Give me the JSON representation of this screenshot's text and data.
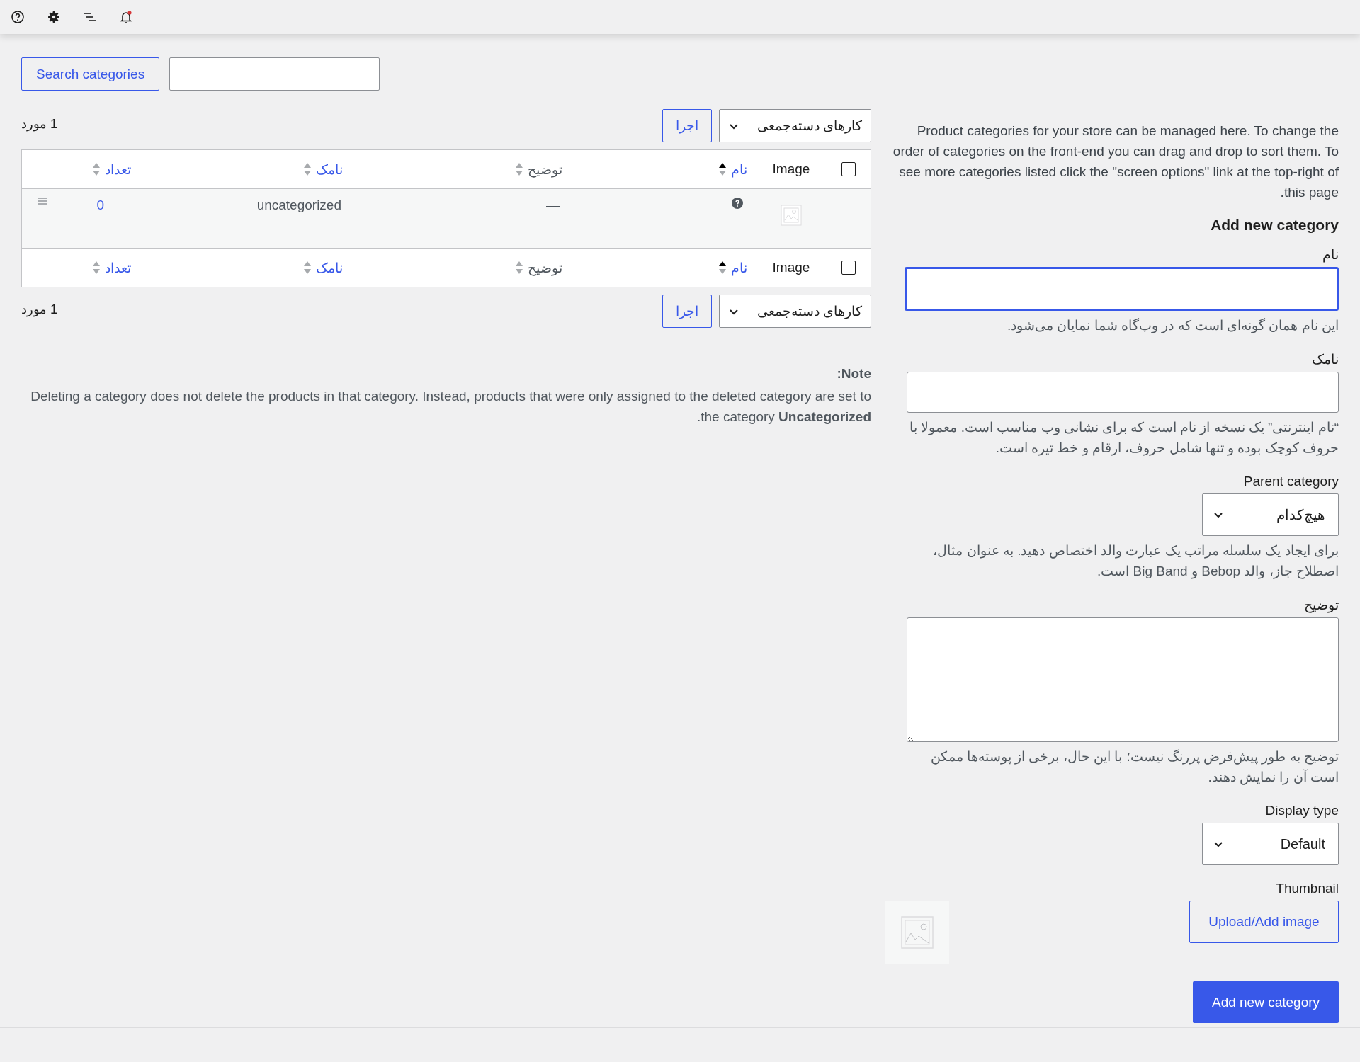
{
  "toolbar": {
    "items": [
      {
        "kind": "help"
      },
      {
        "kind": "settings"
      },
      {
        "kind": "menu"
      },
      {
        "kind": "notifications",
        "alert": true
      }
    ]
  },
  "search": {
    "button": "Search categories"
  },
  "bulk_top": {
    "action": "کارهای دسته‌جمعی",
    "apply": "اجرا",
    "count": "1 مورد"
  },
  "table": {
    "header_checkbox_checked": false,
    "header_columns": [
      {
        "label": "Image",
        "kind": "plain"
      },
      {
        "label": "نام",
        "kind": "sortable",
        "sorted": true
      },
      {
        "label": "توضیح",
        "kind": "sortable",
        "sorted": false
      },
      {
        "label": "نامک",
        "kind": "sortable",
        "sorted": false
      },
      {
        "label": "تعداد",
        "kind": "sortable",
        "sorted": false
      }
    ],
    "rows": [
      {
        "description": "—",
        "slug": "uncategorized",
        "count": "0"
      }
    ],
    "footer_checkbox_checked": false,
    "footer_columns": [
      {
        "label": "Image",
        "kind": "plain"
      },
      {
        "label": "نام",
        "kind": "sortable",
        "sorted": true
      },
      {
        "label": "توضیح",
        "kind": "sortable",
        "sorted": false
      },
      {
        "label": "نامک",
        "kind": "sortable",
        "sorted": false
      },
      {
        "label": "تعداد",
        "kind": "sortable",
        "sorted": false
      }
    ]
  },
  "bulk_bottom": {
    "action": "کارهای دسته‌جمعی",
    "apply": "اجرا",
    "count": "1 مورد"
  },
  "note": {
    "title": "Note:",
    "text": "Deleting a category does not delete the products in that category. Instead, products that were only assigned to the deleted category are set to the category **Uncategorized**."
  },
  "intro": "Product categories for your store can be managed here. To change the order of categories on the front-end you can drag and drop to sort them. To see more categories listed click the \"screen options\" link at the top-right of this page.",
  "form": {
    "heading": "Add new category",
    "fields": [
      {
        "kind": "input",
        "label": "نام",
        "focused": true,
        "hint": "این نام همان گونه‌ای است که در وب‌گاه شما نمایان می‌شود."
      },
      {
        "kind": "input",
        "label": "نامک",
        "focused": false,
        "hint": "“نام اینترنتی” یک نسخه از نام است که برای نشانی وب مناسب است. معمولا با حروف کوچک بوده و تنها شامل حروف، ارقام و خط تیره است."
      },
      {
        "kind": "select",
        "label": "Parent category",
        "value": "هیچ‌کدام",
        "hint": "برای ایجاد یک سلسله مراتب یک عبارت والد اختصاص دهید. به عنوان مثال، اصطلاح جاز، والد Bebop و Big Band است."
      },
      {
        "kind": "textarea",
        "label": "توضیح",
        "hint": "توضیح به طور پیش‌فرض پررنگ نیست؛ با این حال، برخی از پوسته‌ها ممکن است آن را نمایش دهند."
      },
      {
        "kind": "select",
        "label": "Display type",
        "value": "Default"
      },
      {
        "kind": "thumbnail",
        "label": "Thumbnail",
        "button": "Upload/Add image"
      }
    ],
    "submit": "Add new category"
  }
}
